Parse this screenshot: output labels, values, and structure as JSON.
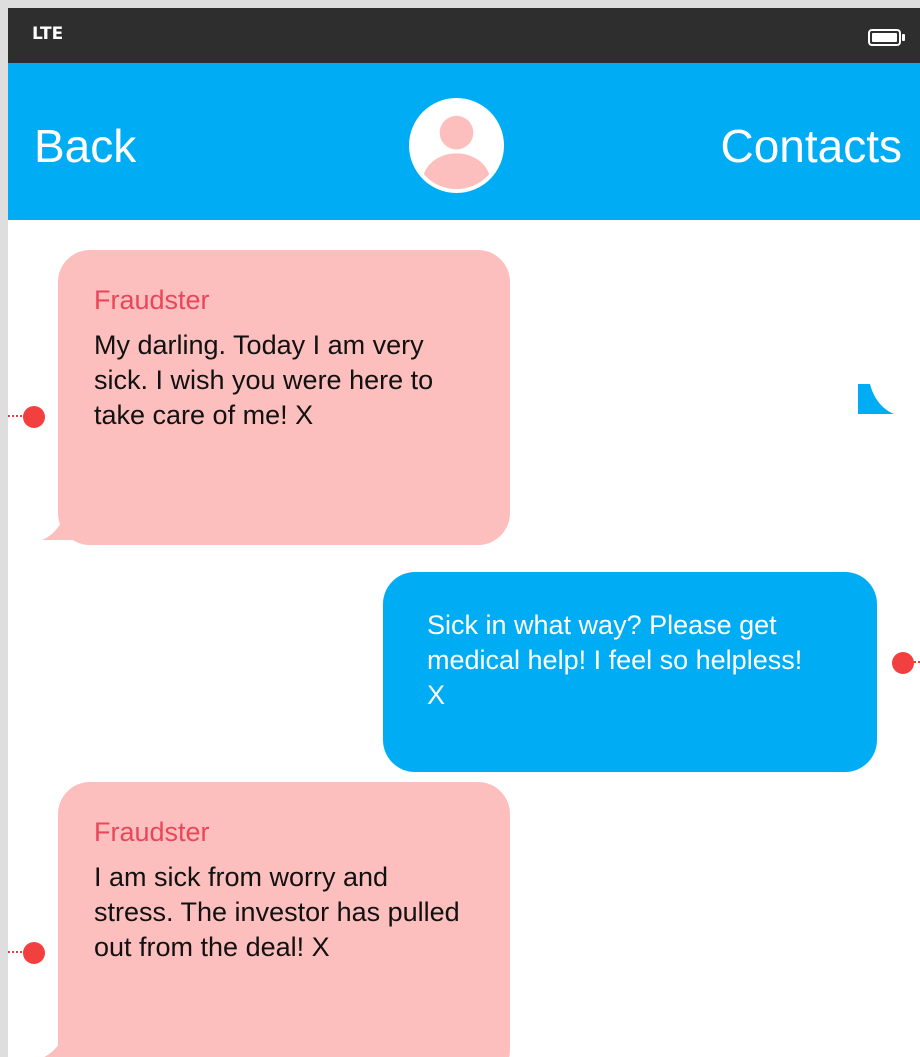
{
  "status_bar": {
    "network": "LTE"
  },
  "nav": {
    "back_label": "Back",
    "contacts_label": "Contacts"
  },
  "messages": [
    {
      "direction": "incoming",
      "sender": "Fraudster",
      "text": "My darling. Today I am very sick. I wish you were here to take care of me! X"
    },
    {
      "direction": "outgoing",
      "text": "Sick in what way? Please get medical help! I feel so helpless! X"
    },
    {
      "direction": "incoming",
      "sender": "Fraudster",
      "text": "I am sick from worry and stress. The investor has pulled out from the deal! X"
    }
  ],
  "colors": {
    "status_bar": "#2e2e2e",
    "nav_bar": "#00adf5",
    "incoming_bubble": "#fdbebe",
    "outgoing_bubble": "#00adf5",
    "sender_name": "#e8475a",
    "annotation_marker": "#f23f3f",
    "avatar": "#fdbebe"
  },
  "icons": {
    "battery": "battery-icon",
    "avatar": "contact-avatar-icon"
  }
}
